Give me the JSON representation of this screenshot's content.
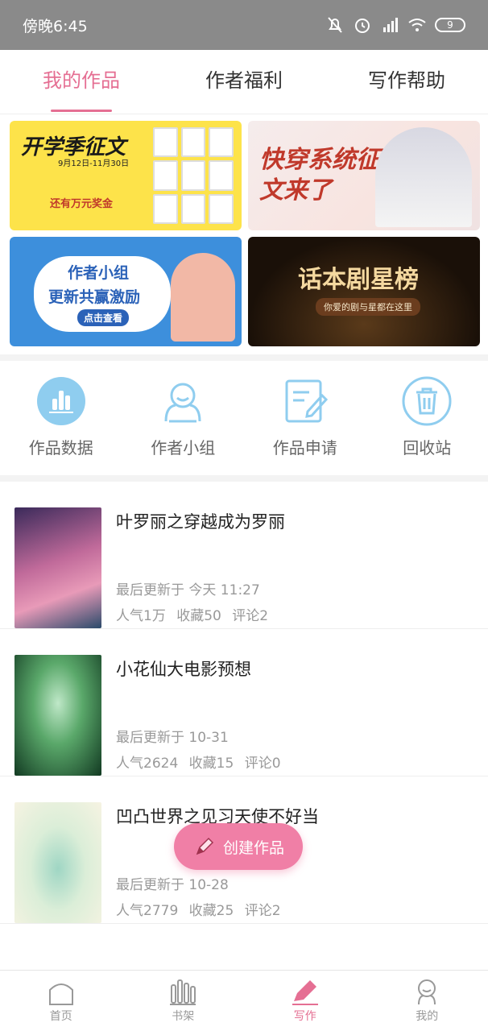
{
  "status_bar": {
    "time": "傍晚6:45",
    "battery": "9"
  },
  "tabs": [
    {
      "label": "我的作品",
      "active": true
    },
    {
      "label": "作者福利",
      "active": false
    },
    {
      "label": "写作帮助",
      "active": false
    }
  ],
  "banners": {
    "b1": {
      "title": "开学季征文",
      "dates": "9月12日-11月30日",
      "prize": "还有万元奖金"
    },
    "b2": {
      "title": "快穿系统征文来了"
    },
    "b3": {
      "title1": "作者小组",
      "title2": "更新共赢激励",
      "button": "点击查看"
    },
    "b4": {
      "title": "话本剧星榜",
      "subtitle": "你爱的剧与星都在这里"
    }
  },
  "shortcuts": [
    {
      "label": "作品数据",
      "icon": "bar-chart-icon"
    },
    {
      "label": "作者小组",
      "icon": "group-icon"
    },
    {
      "label": "作品申请",
      "icon": "edit-doc-icon"
    },
    {
      "label": "回收站",
      "icon": "trash-icon"
    }
  ],
  "works": [
    {
      "title": "叶罗丽之穿越成为罗丽",
      "updated": "最后更新于 今天 11:27",
      "popularity": "人气1万",
      "favorites": "收藏50",
      "comments": "评论2"
    },
    {
      "title": "小花仙大电影预想",
      "updated": "最后更新于 10-31",
      "popularity": "人气2624",
      "favorites": "收藏15",
      "comments": "评论0"
    },
    {
      "title": "凹凸世界之见习天使不好当",
      "updated": "最后更新于 10-28",
      "popularity": "人气2779",
      "favorites": "收藏25",
      "comments": "评论2"
    }
  ],
  "fab": {
    "label": "创建作品"
  },
  "bottom_nav": [
    {
      "label": "首页",
      "active": false
    },
    {
      "label": "书架",
      "active": false
    },
    {
      "label": "写作",
      "active": true
    },
    {
      "label": "我的",
      "active": false
    }
  ],
  "colors": {
    "accent": "#e56f93",
    "icon_blue": "#8fcdef",
    "fab": "#f07fa6"
  }
}
